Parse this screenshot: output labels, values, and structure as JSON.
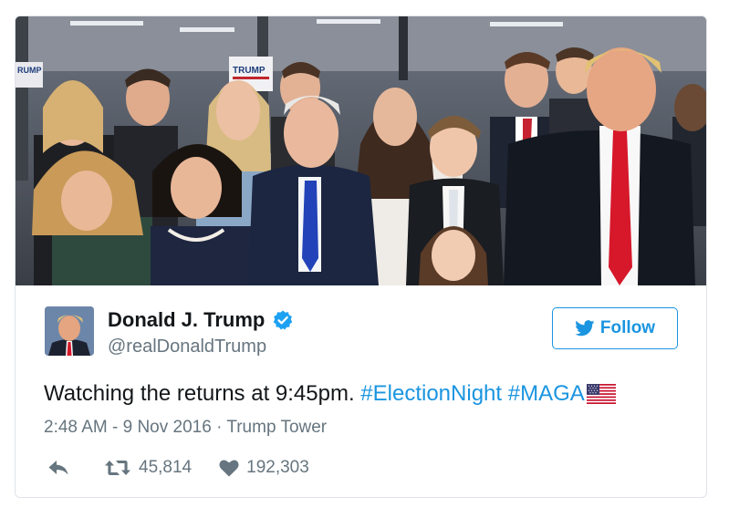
{
  "photo": {
    "description_icon": "group-photo",
    "sign_left": "RUMP",
    "sign_right": "TRUMP"
  },
  "author": {
    "name": "Donald J. Trump",
    "handle": "@realDonaldTrump",
    "verified_icon": "verified-badge-icon"
  },
  "follow": {
    "label": "Follow",
    "icon": "twitter-bird-icon"
  },
  "tweet": {
    "text": "Watching the returns at 9:45pm.",
    "hashtag1": "#ElectionNight",
    "hashtag2": "#MAGA",
    "emoji_icon": "us-flag-icon"
  },
  "meta": {
    "timestamp": "2:48 AM - 9 Nov 2016",
    "separator": "·",
    "location": "Trump Tower"
  },
  "actions": {
    "reply_icon": "reply-icon",
    "retweet_icon": "retweet-icon",
    "retweets": "45,814",
    "like_icon": "heart-icon",
    "likes": "192,303"
  },
  "colors": {
    "accent": "#1b95e0",
    "text": "#14171a",
    "muted": "#66757f",
    "border": "#dfe3e8"
  }
}
